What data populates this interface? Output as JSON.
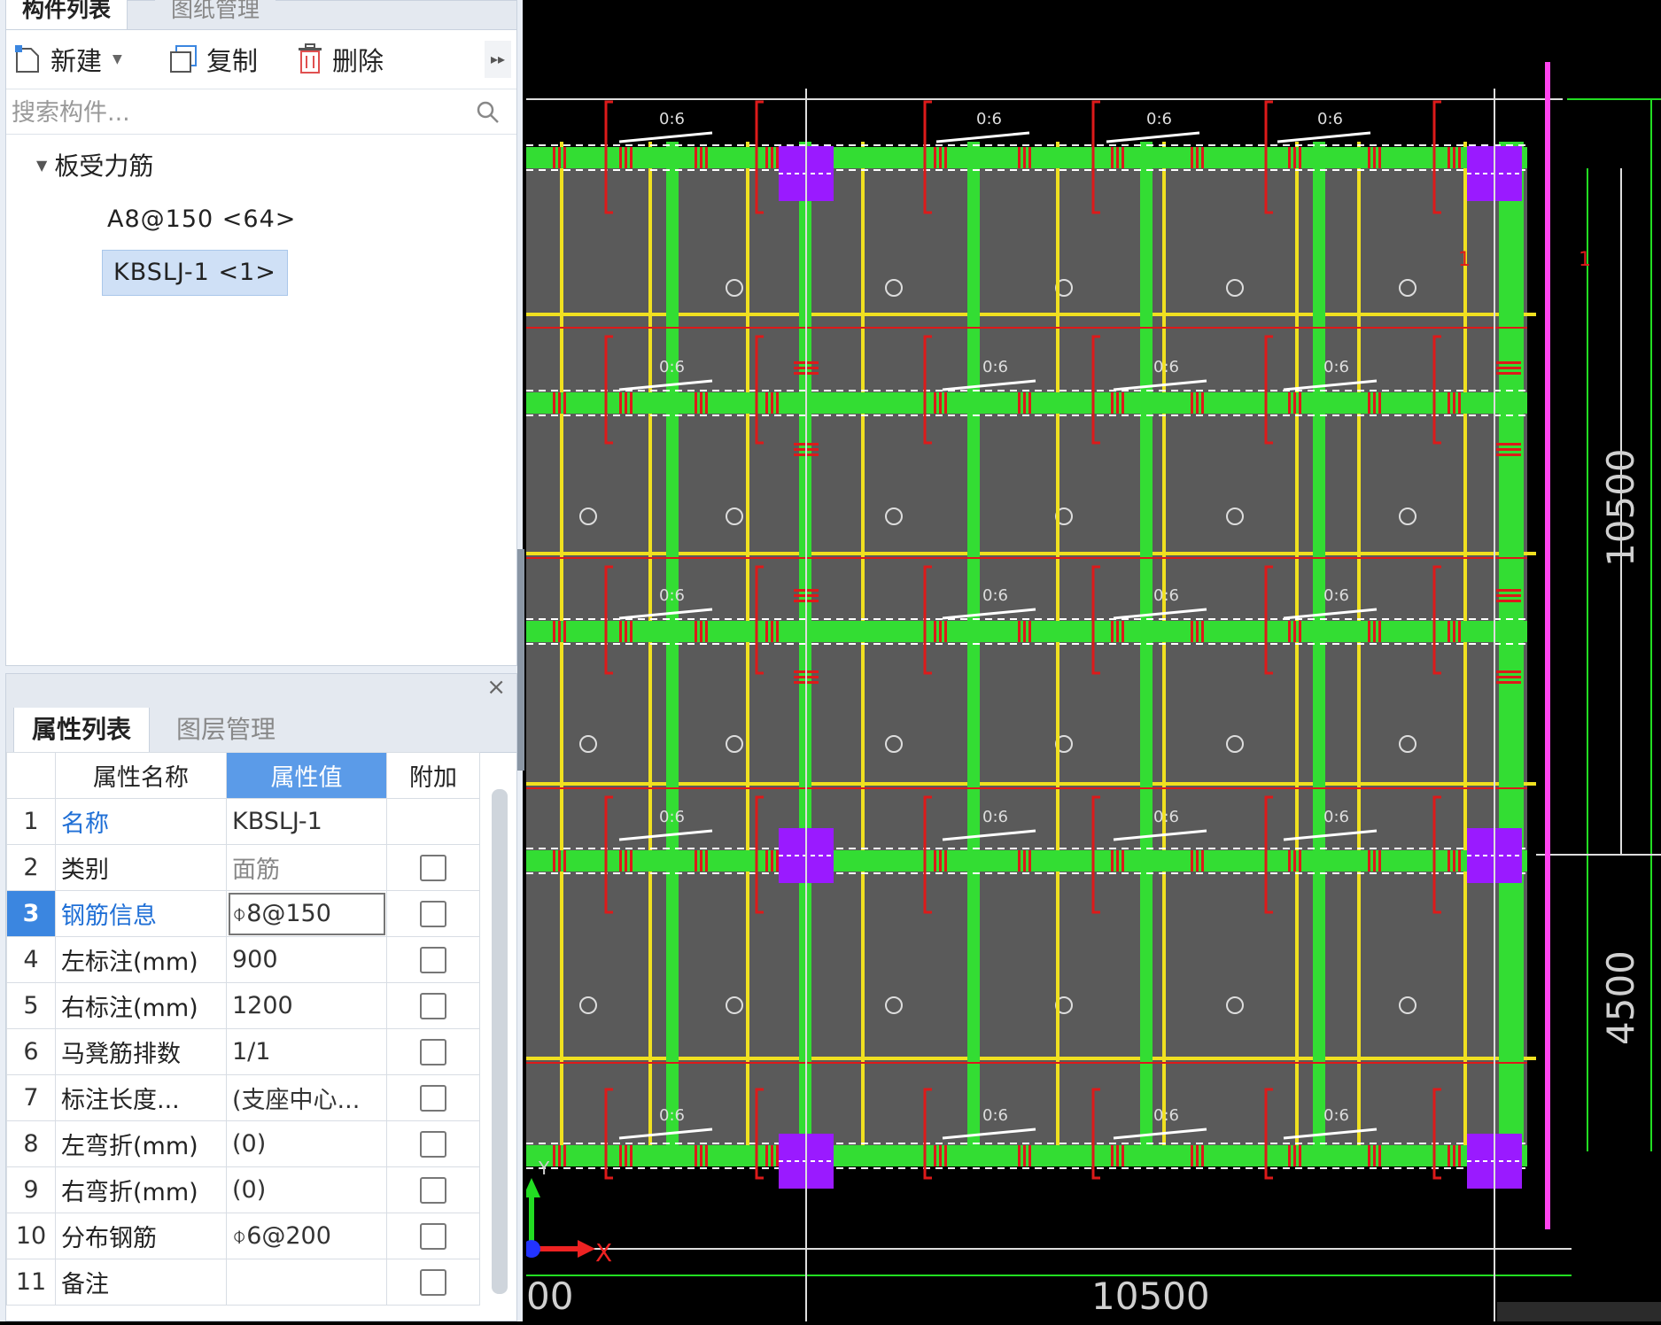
{
  "component_panel": {
    "tabs": [
      "构件列表",
      "图纸管理"
    ],
    "toolbar": {
      "new_label": "新建",
      "copy_label": "复制",
      "delete_label": "删除"
    },
    "search_placeholder": "搜索构件...",
    "tree": {
      "group_label": "板受力筋",
      "items": [
        "A8@150 <64>",
        "KBSLJ-1 <1>"
      ]
    }
  },
  "property_panel": {
    "tabs": [
      "属性列表",
      "图层管理"
    ],
    "close_glyph": "×",
    "headers": [
      "属性名称",
      "属性值",
      "附加"
    ],
    "rows": [
      {
        "num": "1",
        "name": "名称",
        "value": "KBSLJ-1"
      },
      {
        "num": "2",
        "name": "类别",
        "value": "面筋"
      },
      {
        "num": "3",
        "name": "钢筋信息",
        "value": "⌽8@150"
      },
      {
        "num": "4",
        "name": "左标注(mm)",
        "value": "900"
      },
      {
        "num": "5",
        "name": "右标注(mm)",
        "value": "1200"
      },
      {
        "num": "6",
        "name": "马凳筋排数",
        "value": "1/1"
      },
      {
        "num": "7",
        "name": "标注长度...",
        "value": "(支座中心..."
      },
      {
        "num": "8",
        "name": "左弯折(mm)",
        "value": "(0)"
      },
      {
        "num": "9",
        "name": "右弯折(mm)",
        "value": "(0)"
      },
      {
        "num": "10",
        "name": "分布钢筋",
        "value": "⌽6@200"
      },
      {
        "num": "11",
        "name": "备注",
        "value": ""
      }
    ]
  },
  "drawing": {
    "bar_label": "0:6",
    "dim_vertical_1": "10500",
    "dim_vertical_2": "4500",
    "dim_horizontal": "10500",
    "dim_left_partial": "00",
    "axis_x_label": "X",
    "axis_y_label": "Y",
    "section_mark": "1",
    "colors": {
      "background": "#000000",
      "slab": "#5a5a5a",
      "beam": "#33dd33",
      "grid": "#f0e020",
      "rebar": "#dd1a1a",
      "column": "#9a1aff",
      "boundary": "#ff44ee"
    }
  }
}
